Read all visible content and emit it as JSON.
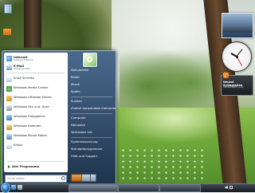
{
  "wallpaper": {
    "caption_line1": "",
    "caption_line2": ""
  },
  "desktop": {
    "icons": []
  },
  "sidebar": {
    "rss_title": "Neuest Schlagzeilen",
    "rss_sub": "Meldungen (10)"
  },
  "start_menu": {
    "pinned": [
      {
        "label": "Internet",
        "sub": "Internet Explorer"
      },
      {
        "label": "E-Mail",
        "sub": "Windows Mail"
      }
    ],
    "recent": [
      {
        "label": "Erste Schritte"
      },
      {
        "label": "Windows Media Center"
      },
      {
        "label": "Windows Ultimate Extras"
      },
      {
        "label": "Windows-Fax und -Scan"
      },
      {
        "label": "Windows Fotogalerie"
      },
      {
        "label": "Windows Kalender"
      },
      {
        "label": "Windows Movie Maker"
      },
      {
        "label": "Editor"
      }
    ],
    "all_programs": "Alle Programme",
    "search_placeholder": "Suche starten",
    "right_items": [
      "Dokumente",
      "Bilder",
      "Musik",
      "Spiele",
      "Suchen",
      "Zuletzt verwendete Elemente",
      "Computer",
      "Netzwerk",
      "Verbinden mit",
      "Systemsteuerung",
      "Standardprogramme",
      "Hilfe und Support"
    ],
    "user_name": ""
  },
  "taskbar": {
    "buttons": [
      {
        "label": ""
      },
      {
        "label": ""
      },
      {
        "label": ""
      }
    ],
    "clock": ""
  },
  "colors": {
    "start_menu_gradient_top": "#4a6a8d",
    "start_menu_gradient_bottom": "#1f344d",
    "taskbar": "#161b21",
    "accent_orb": "#2d7cc2"
  }
}
